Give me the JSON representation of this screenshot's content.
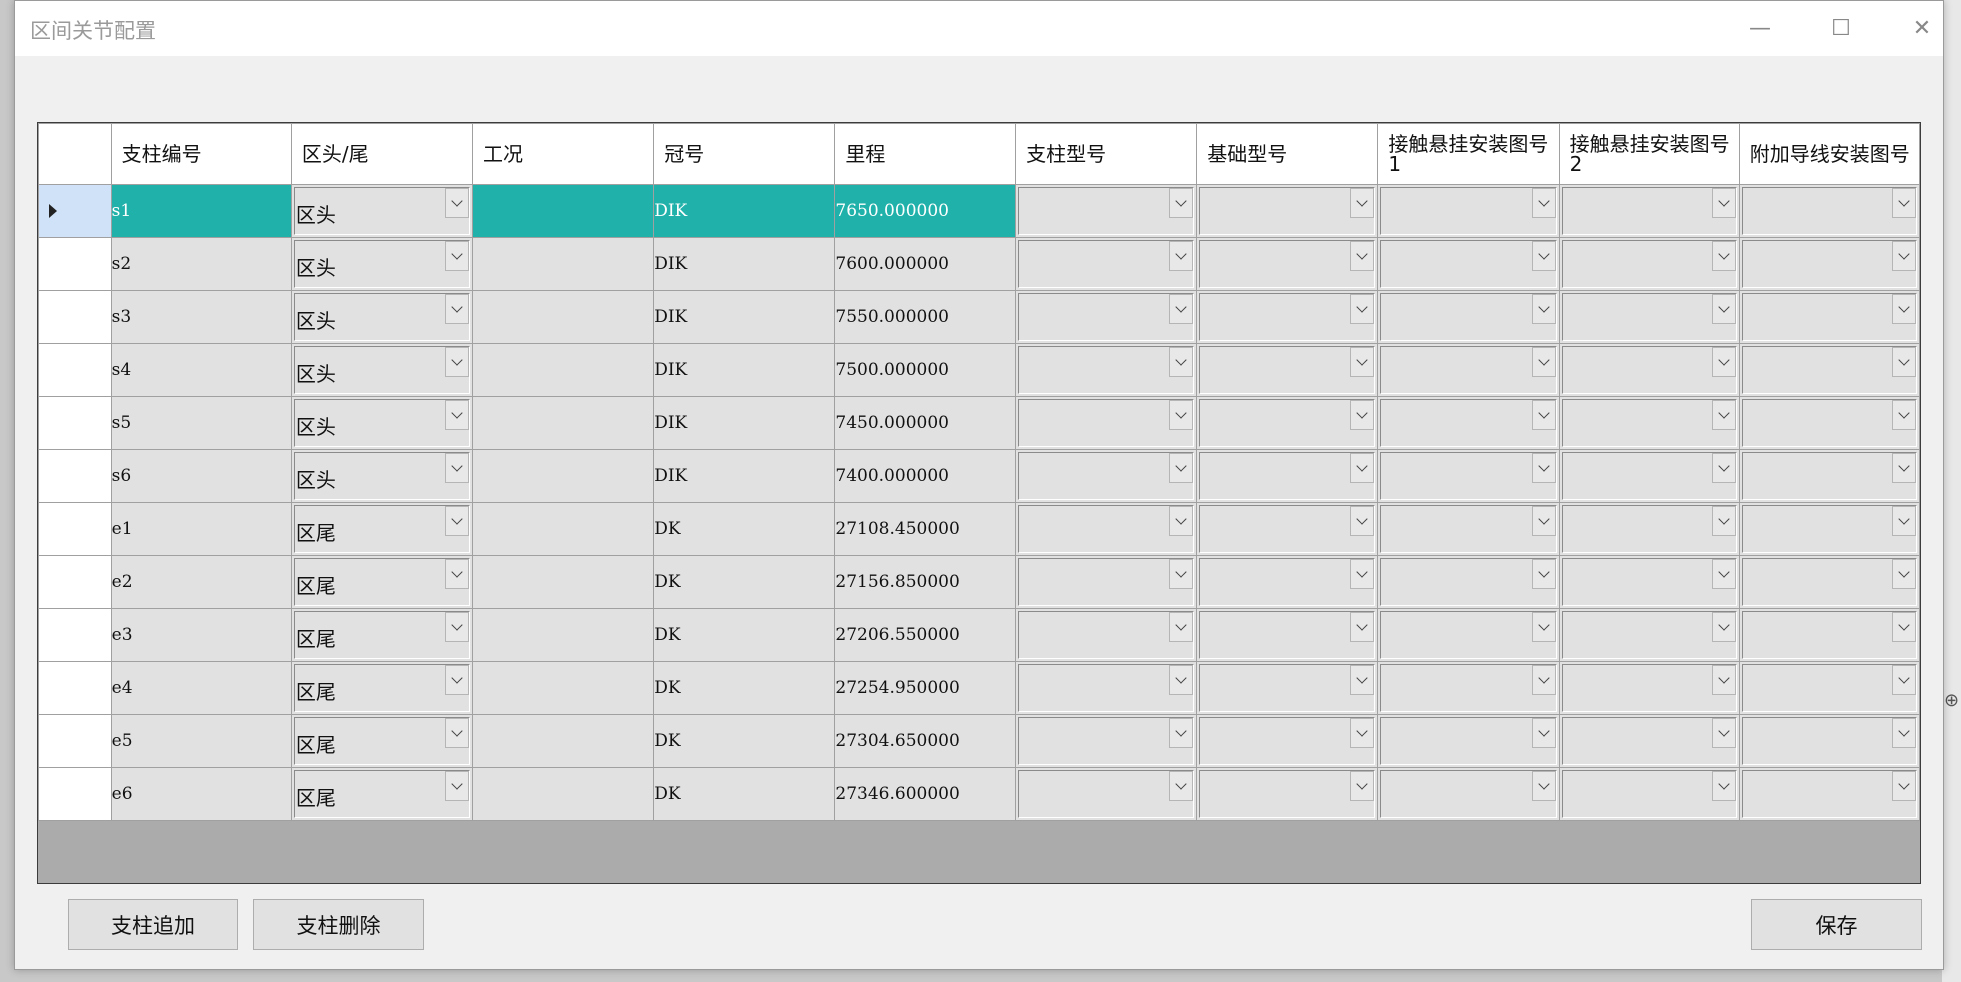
{
  "window": {
    "title": "区间关节配置",
    "minimize_glyph": "—",
    "maximize_glyph": "☐",
    "close_glyph": "✕"
  },
  "grid": {
    "columns": [
      "支柱编号",
      "区头/尾",
      "工况",
      "冠号",
      "里程",
      "支柱型号",
      "基础型号",
      "接触悬挂安装图号1",
      "接触悬挂安装图号2",
      "附加导线安装图号"
    ],
    "rows": [
      {
        "id": "s1",
        "end": "区头",
        "condition": "",
        "prefix": "DIK",
        "mileage": "7650.000000",
        "selected": true
      },
      {
        "id": "s2",
        "end": "区头",
        "condition": "",
        "prefix": "DIK",
        "mileage": "7600.000000",
        "selected": false
      },
      {
        "id": "s3",
        "end": "区头",
        "condition": "",
        "prefix": "DIK",
        "mileage": "7550.000000",
        "selected": false
      },
      {
        "id": "s4",
        "end": "区头",
        "condition": "",
        "prefix": "DIK",
        "mileage": "7500.000000",
        "selected": false
      },
      {
        "id": "s5",
        "end": "区头",
        "condition": "",
        "prefix": "DIK",
        "mileage": "7450.000000",
        "selected": false
      },
      {
        "id": "s6",
        "end": "区头",
        "condition": "",
        "prefix": "DIK",
        "mileage": "7400.000000",
        "selected": false
      },
      {
        "id": "e1",
        "end": "区尾",
        "condition": "",
        "prefix": "DK",
        "mileage": "27108.450000",
        "selected": false
      },
      {
        "id": "e2",
        "end": "区尾",
        "condition": "",
        "prefix": "DK",
        "mileage": "27156.850000",
        "selected": false
      },
      {
        "id": "e3",
        "end": "区尾",
        "condition": "",
        "prefix": "DK",
        "mileage": "27206.550000",
        "selected": false
      },
      {
        "id": "e4",
        "end": "区尾",
        "condition": "",
        "prefix": "DK",
        "mileage": "27254.950000",
        "selected": false
      },
      {
        "id": "e5",
        "end": "区尾",
        "condition": "",
        "prefix": "DK",
        "mileage": "27304.650000",
        "selected": false
      },
      {
        "id": "e6",
        "end": "区尾",
        "condition": "",
        "prefix": "DK",
        "mileage": "27346.600000",
        "selected": false
      }
    ]
  },
  "buttons": {
    "add": "支柱追加",
    "delete": "支柱删除",
    "save": "保存"
  },
  "colors": {
    "selection": "#20b2aa",
    "cell_bg": "#e1e1e1",
    "current_row_header": "#cfe2f7"
  }
}
